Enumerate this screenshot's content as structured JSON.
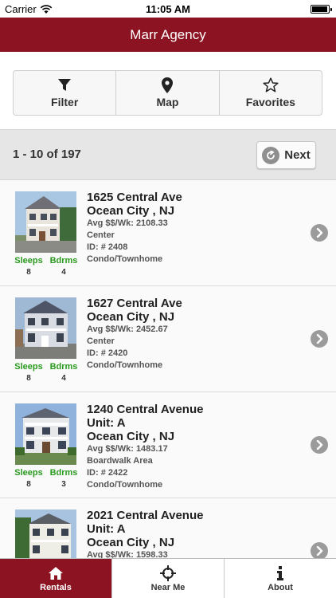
{
  "status_bar": {
    "carrier": "Carrier",
    "time": "11:05 AM"
  },
  "header": {
    "title": "Marr Agency"
  },
  "toolbar": {
    "filter_label": "Filter",
    "map_label": "Map",
    "favorites_label": "Favorites"
  },
  "pager": {
    "count": "1 - 10 of 197",
    "next_label": "Next"
  },
  "listings": [
    {
      "address_lines": [
        "1625 Central Ave",
        "Ocean City , NJ"
      ],
      "avg": "Avg $$/Wk: 2108.33",
      "area": "Center",
      "id": "ID: # 2408",
      "type": "Condo/Townhome",
      "sleeps": "8",
      "bdrms": "4"
    },
    {
      "address_lines": [
        "1627 Central Ave",
        "Ocean City , NJ"
      ],
      "avg": "Avg $$/Wk: 2452.67",
      "area": "Center",
      "id": "ID: # 2420",
      "type": "Condo/Townhome",
      "sleeps": "8",
      "bdrms": "4"
    },
    {
      "address_lines": [
        "1240 Central Avenue",
        "Unit: A",
        "Ocean City , NJ"
      ],
      "avg": "Avg $$/Wk: 1483.17",
      "area": "Boardwalk Area",
      "id": "ID: # 2422",
      "type": "Condo/Townhome",
      "sleeps": "8",
      "bdrms": "3"
    },
    {
      "address_lines": [
        "2021 Central Avenue",
        "Unit: A",
        "Ocean City , NJ"
      ],
      "avg": "Avg $$/Wk: 1598.33",
      "area": "",
      "id": "",
      "type": "",
      "sleeps": "",
      "bdrms": ""
    }
  ],
  "labels": {
    "sleeps": "Sleeps",
    "bdrms": "Bdrms"
  },
  "tabs": [
    {
      "label": "Rentals",
      "icon": "home-icon"
    },
    {
      "label": "Near Me",
      "icon": "crosshair-icon"
    },
    {
      "label": "About",
      "icon": "info-icon"
    }
  ],
  "colors": {
    "brand": "#8c1321",
    "stat_green": "#2a9a1f"
  }
}
